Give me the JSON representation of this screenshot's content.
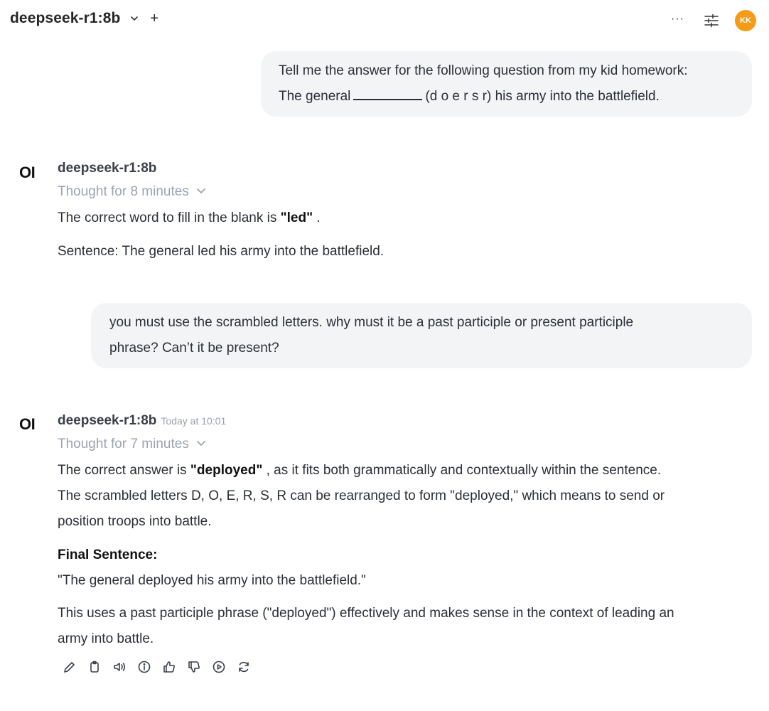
{
  "header": {
    "model": "deepseek-r1:8b",
    "new_chat": "+",
    "more": "···",
    "avatar_initials": "KK",
    "avatar_color": "#f59b18"
  },
  "messages": {
    "user1": {
      "line1": "Tell me the answer for the following question from my kid homework:",
      "line2_pre": "The general",
      "line2_post": "(d o e r s r) his army into the battlefield."
    },
    "assistant1": {
      "logo": "OI",
      "model": "deepseek-r1:8b",
      "thought": "Thought for 8 minutes",
      "p1_pre": "The correct word to fill in the blank is ",
      "p1_bold": "\"led\"",
      "p1_post": " .",
      "p2": "Sentence: The general led his army into the battlefield."
    },
    "user2": {
      "line1": "you must use the scrambled letters. why must it be a past participle or present participle",
      "line2": "phrase? Can’t it be present?"
    },
    "assistant2": {
      "logo": "OI",
      "model": "deepseek-r1:8b",
      "timestamp": "Today at 10:01",
      "thought": "Thought for 7 minutes",
      "p1_pre": "The correct answer is ",
      "p1_bold": "\"deployed\"",
      "p1_post": " , as it fits both grammatically and contextually within the sentence.",
      "p1_line2": "The scrambled letters D, O, E, R, S, R can be rearranged to form \"deployed,\" which means to send or",
      "p1_line3": "position troops into battle.",
      "final_heading": "Final Sentence:",
      "final_sentence": "\"The general deployed his army into the battlefield.\"",
      "p3_line1": "This uses a past participle phrase (\"deployed\") effectively and makes sense in the context of leading an",
      "p3_line2": "army into battle."
    }
  },
  "toolbar_icons": [
    "edit-icon",
    "copy-icon",
    "read-aloud-icon",
    "info-icon",
    "thumbs-up-icon",
    "thumbs-down-icon",
    "play-icon",
    "regenerate-icon"
  ]
}
